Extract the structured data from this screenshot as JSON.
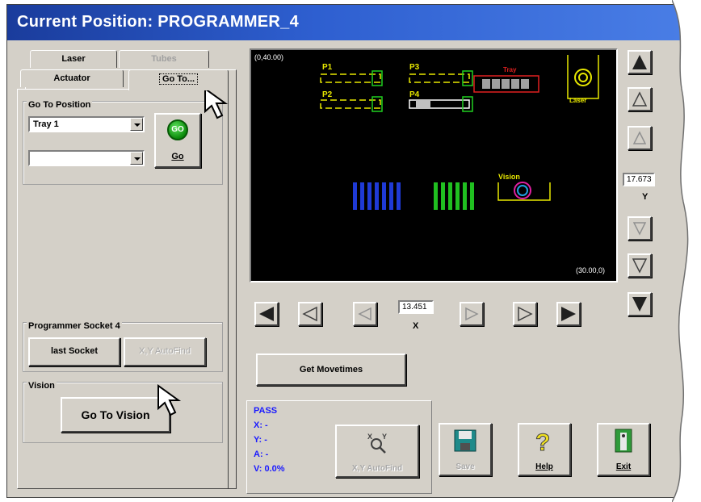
{
  "window": {
    "title": "Current Position: PROGRAMMER_4"
  },
  "tabs": {
    "laser": "Laser",
    "tubes": "Tubes",
    "actuator": "Actuator",
    "goto": "Go To..."
  },
  "goto_position": {
    "title": "Go To Position",
    "select1_value": "Tray 1",
    "select2_value": "",
    "go_icon_text": "GO",
    "go_label": "Go"
  },
  "programmer_socket": {
    "title": "Programmer Socket  4",
    "last_socket": "last Socket",
    "xy_autofind": "X,Y AutoFind"
  },
  "vision": {
    "title": "Vision",
    "go_to_vision": "Go To Vision"
  },
  "camera": {
    "top_left_coord": "(0,40.00)",
    "bottom_right_coord": "(30.00,0)",
    "p1": "P1",
    "p2": "P2",
    "p3": "P3",
    "p4": "P4",
    "vision_label": "Vision",
    "laser_label": "Laser",
    "tray_label": "Tray"
  },
  "y_value": "17.673",
  "y_label": "Y",
  "x_value": "13.451",
  "x_label": "X",
  "get_movetimes": "Get Movetimes",
  "status": {
    "result": "PASS",
    "x": "X: -",
    "y": "Y: -",
    "a": "A: -",
    "v": "V: 0.0%"
  },
  "buttons": {
    "xy_autofind": "X,Y AutoFind",
    "save": "Save",
    "help": "Help",
    "exit": "Exit"
  },
  "colors": {
    "title_gradient_start": "#1a3c9c",
    "title_gradient_end": "#4a7ee6",
    "status_text": "#1a1aff",
    "go_green": "#0b8a0b"
  }
}
